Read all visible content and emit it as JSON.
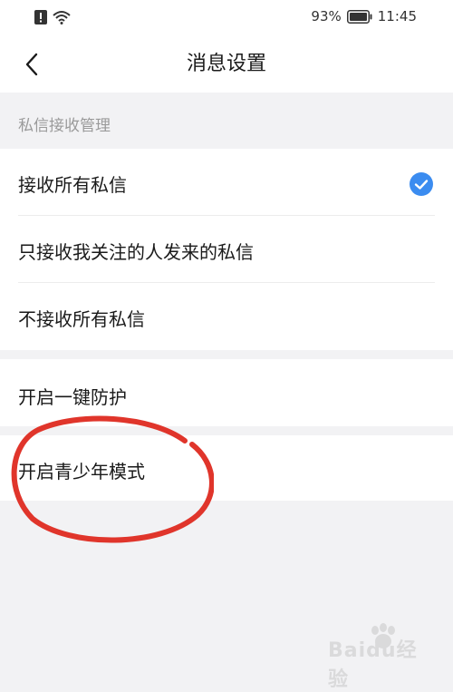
{
  "status_bar": {
    "battery_percent": "93%",
    "time": "11:45",
    "icons": [
      "alert-icon",
      "wifi-icon",
      "battery-icon"
    ]
  },
  "nav": {
    "title": "消息设置",
    "back_icon": "chevron-left-icon"
  },
  "section": {
    "header": "私信接收管理"
  },
  "dm_options": [
    {
      "label": "接收所有私信",
      "selected": true
    },
    {
      "label": "只接收我关注的人发来的私信",
      "selected": false
    },
    {
      "label": "不接收所有私信",
      "selected": false
    }
  ],
  "protection": {
    "label": "开启一键防护"
  },
  "teen_mode": {
    "label": "开启青少年模式"
  },
  "watermark": {
    "text": "Baidu经验"
  },
  "colors": {
    "accent": "#3b8cf0",
    "annotation": "#e0352b",
    "background": "#f2f2f4"
  }
}
